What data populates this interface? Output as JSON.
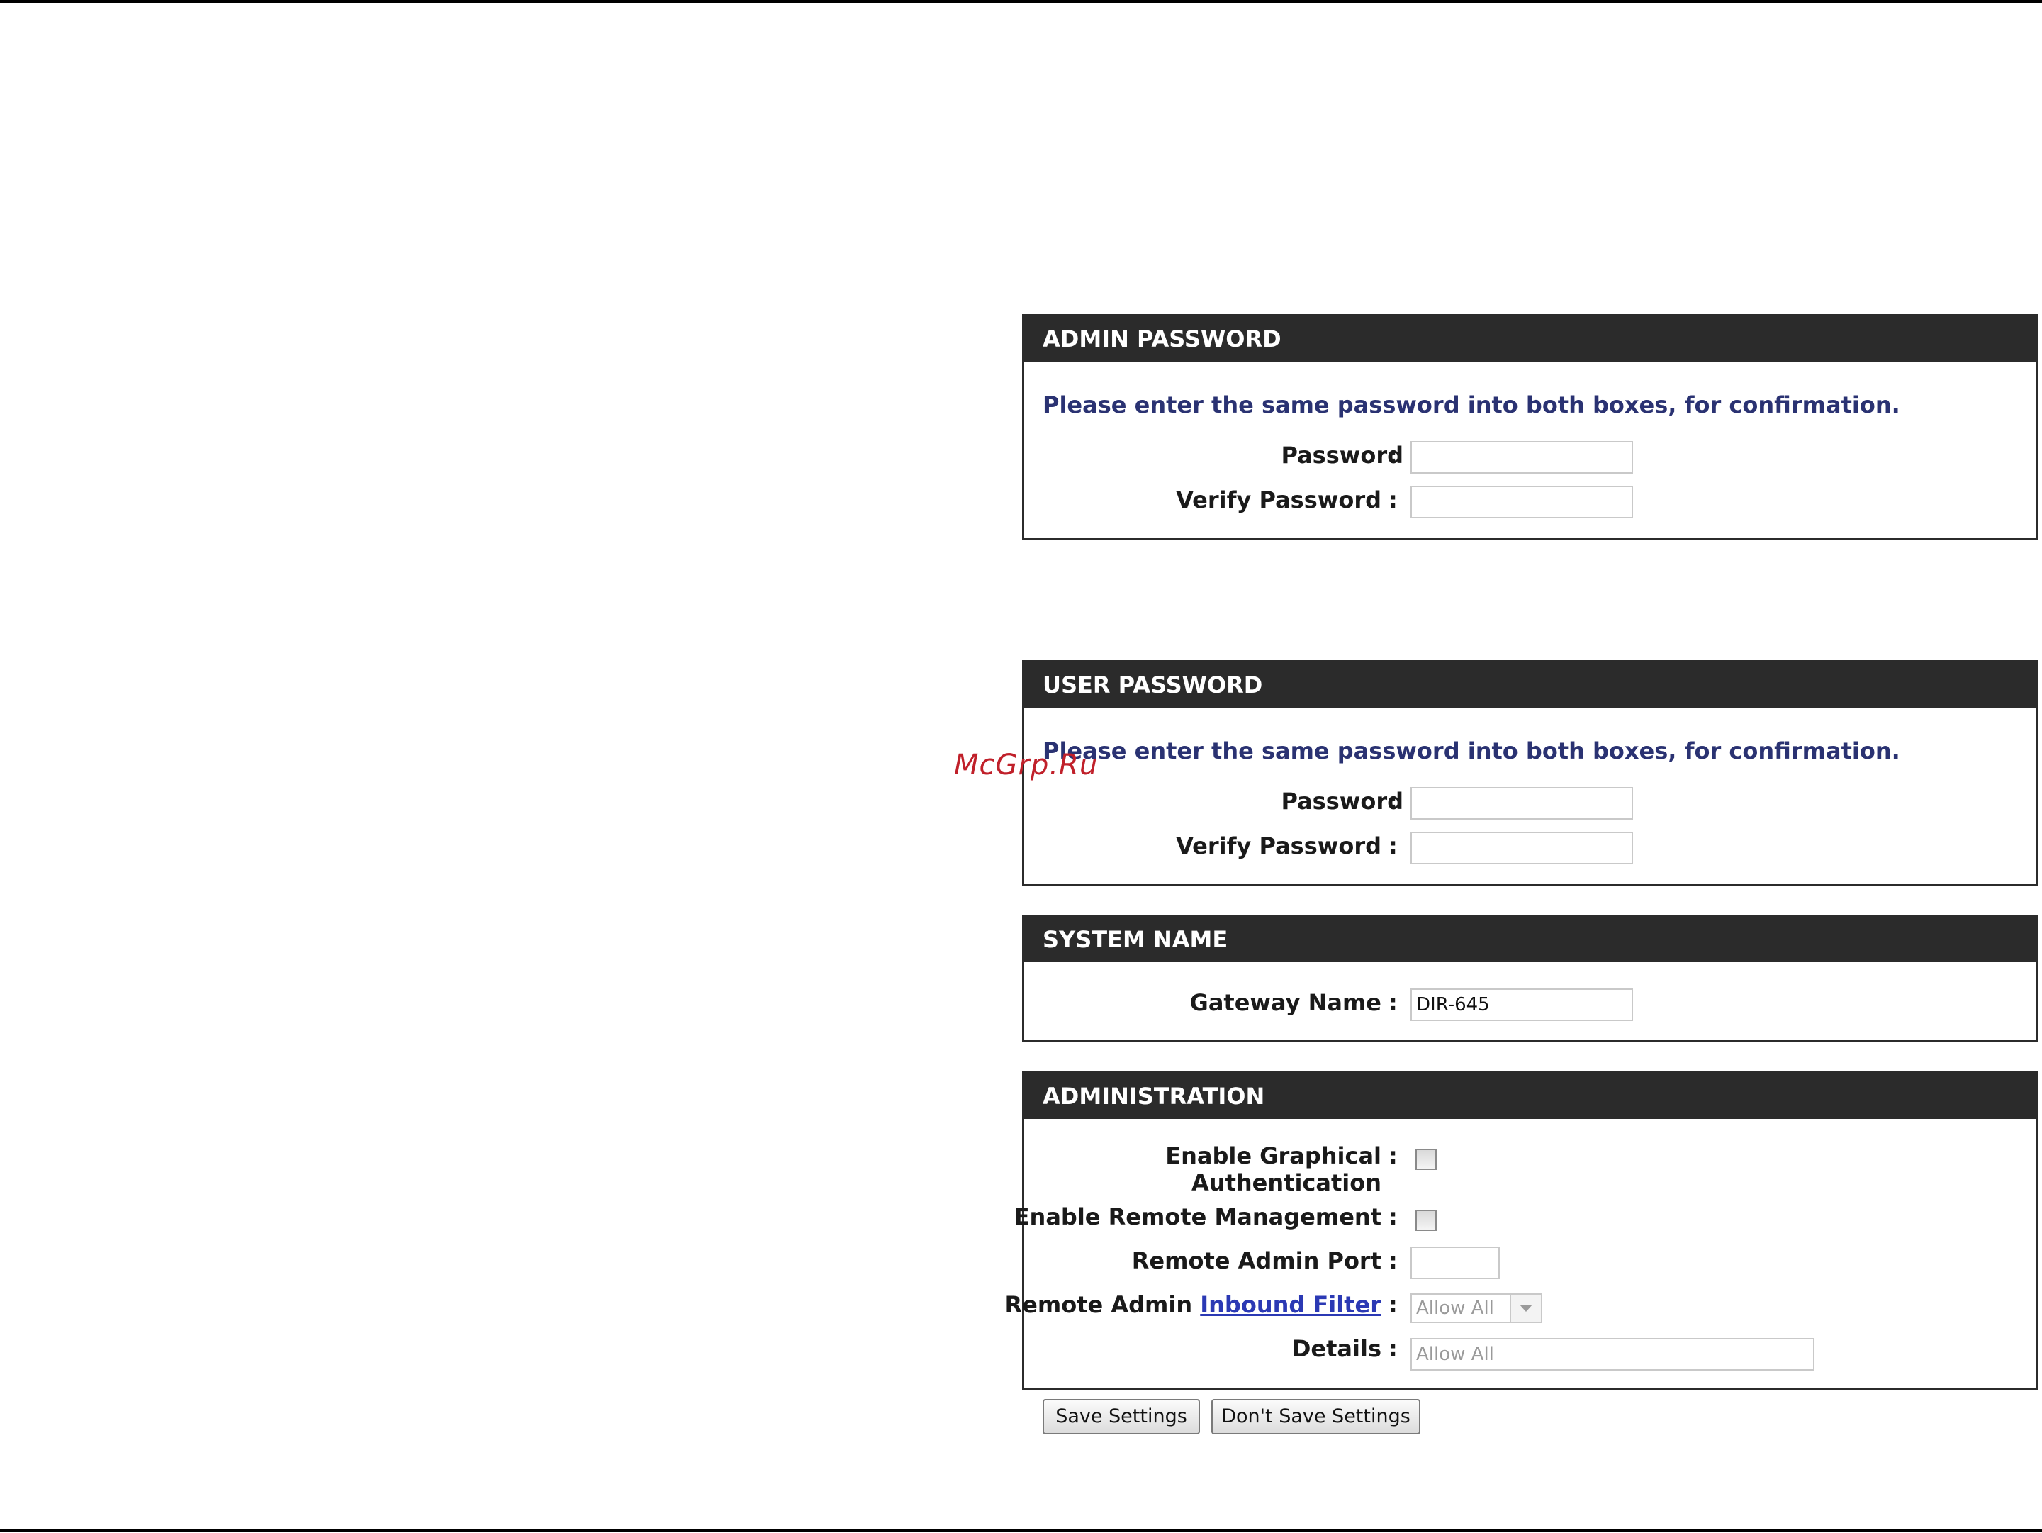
{
  "admin_password": {
    "title": "ADMIN PASSWORD",
    "instruction": "Please enter the same password into both boxes, for confirmation.",
    "password_label": "Password",
    "verify_label": "Verify Password",
    "password_value": "",
    "verify_value": ""
  },
  "user_password": {
    "title": "USER PASSWORD",
    "instruction": "Please enter the same password into both boxes, for confirmation.",
    "password_label": "Password",
    "verify_label": "Verify Password",
    "password_value": "",
    "verify_value": ""
  },
  "system_name": {
    "title": "SYSTEM NAME",
    "gateway_label": "Gateway Name",
    "gateway_value": "DIR-645"
  },
  "administration": {
    "title": "ADMINISTRATION",
    "graphical_auth_label_line1": "Enable Graphical",
    "graphical_auth_label_line2": "Authentication",
    "graphical_auth_checked": false,
    "remote_mgmt_label": "Enable Remote Management",
    "remote_mgmt_checked": false,
    "remote_port_label": "Remote Admin Port",
    "remote_port_value": "",
    "inbound_label_prefix": "Remote Admin",
    "inbound_link_text": "Inbound Filter",
    "inbound_selected": "Allow All",
    "details_label": "Details",
    "details_value": "Allow All"
  },
  "buttons": {
    "save": "Save Settings",
    "dont_save": "Don't Save Settings"
  },
  "colon": ":",
  "watermark": "McGrp.Ru"
}
